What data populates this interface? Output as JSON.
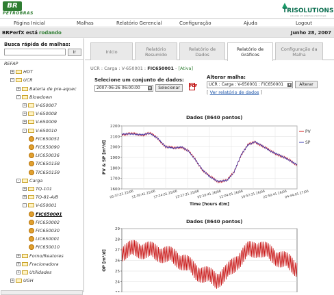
{
  "header": {
    "brand_mark": "BR",
    "brand_name": "PETROBRAS",
    "partner_name": "TRISOLUTIONS",
    "partner_tagline": "soluções em sistemas e tecnologia",
    "brand_color": "#2f7d32"
  },
  "menu": {
    "items": [
      "Página Inicial",
      "Malhas",
      "Relatório Gerencial",
      "Configuração",
      "Ajuda",
      "Logout"
    ]
  },
  "status": {
    "label": "BRPerfX está",
    "value": "rodando",
    "date": "Junho 28, 2007"
  },
  "search": {
    "label": "Busca rápida de malhas:",
    "value": "",
    "button": "Ir"
  },
  "tree": [
    {
      "label": "REFAP",
      "exp": "",
      "icon": "none"
    },
    {
      "label": "HDT",
      "exp": "+",
      "icon": "folder-icon"
    },
    {
      "label": "UCR",
      "exp": "-",
      "icon": "folder-icon"
    },
    {
      "label": "Bateria de pre-aquec",
      "exp": "+",
      "icon": "folder-icon"
    },
    {
      "label": "Blowdown",
      "exp": "-",
      "icon": "folder-icon"
    },
    {
      "label": "V-650007",
      "exp": "+",
      "icon": "folder-icon"
    },
    {
      "label": "V-650008",
      "exp": "+",
      "icon": "folder-icon"
    },
    {
      "label": "V-650009",
      "exp": "+",
      "icon": "folder-icon"
    },
    {
      "label": "V-650010",
      "exp": "-",
      "icon": "folder-icon"
    },
    {
      "label": "FIC650051",
      "exp": "",
      "icon": "gear-icon"
    },
    {
      "label": "FIC650090",
      "exp": "",
      "icon": "gear-icon"
    },
    {
      "label": "LIC650036",
      "exp": "",
      "icon": "gear-icon"
    },
    {
      "label": "TIC650158",
      "exp": "",
      "icon": "gear-icon"
    },
    {
      "label": "TIC650159",
      "exp": "",
      "icon": "gear-icon"
    },
    {
      "label": "Carga",
      "exp": "-",
      "icon": "folder-icon"
    },
    {
      "label": "TQ-101",
      "exp": "+",
      "icon": "folder-icon"
    },
    {
      "label": "TQ-81-A/B",
      "exp": "+",
      "icon": "folder-icon"
    },
    {
      "label": "V-650001",
      "exp": "-",
      "icon": "folder-icon"
    },
    {
      "label": "FIC650001",
      "exp": "",
      "icon": "gear-icon",
      "selected": true
    },
    {
      "label": "FIC650002",
      "exp": "",
      "icon": "gear-icon"
    },
    {
      "label": "FIC650030",
      "exp": "",
      "icon": "gear-icon"
    },
    {
      "label": "LIC650001",
      "exp": "",
      "icon": "gear-icon"
    },
    {
      "label": "PIC650010",
      "exp": "",
      "icon": "gear-icon"
    },
    {
      "label": "Forno/Reatores",
      "exp": "+",
      "icon": "folder-icon"
    },
    {
      "label": "Fracionadora",
      "exp": "+",
      "icon": "folder-icon"
    },
    {
      "label": "Utilidades",
      "exp": "+",
      "icon": "folder-icon"
    },
    {
      "label": "UGH",
      "exp": "+",
      "icon": "folder-icon"
    }
  ],
  "tabs": [
    {
      "line1": "Início",
      "line2": ""
    },
    {
      "line1": "Relatório",
      "line2": "Resumido"
    },
    {
      "line1": "Relatório de",
      "line2": "Dados"
    },
    {
      "line1": "Relatório de",
      "line2": "Gráficos",
      "active": true
    },
    {
      "line1": "Configuração da",
      "line2": "Malha"
    }
  ],
  "breadcrumb": {
    "path": "UCR : Carga : V-650001 : ",
    "current": "FIC650001",
    "status": "[Ativa]"
  },
  "dataset": {
    "label": "Selecione um conjunto de dados:",
    "value": "2007-06-26 06:00:00",
    "button": "Selecionar"
  },
  "loop_change": {
    "label": "Alterar malha:",
    "value": "UCR : Carga : V-650001 : FIC650001",
    "button": "Alterar",
    "link_prefix": "[ ",
    "link": "Ver relatório de dados",
    "link_suffix": " ]"
  },
  "chart_data": [
    {
      "type": "line",
      "title": "Dados (8640 pontos)",
      "xlabel": "Time [hours d/m]",
      "ylabel": "PV & SP [m³/d]",
      "ylim": [
        1600,
        2200
      ],
      "yticks": [
        1600,
        1700,
        1800,
        1900,
        2000,
        2100,
        2200
      ],
      "xticks": [
        "05:37:21 25/06",
        "11:30:41 25/06",
        "17:24:01 25/06",
        "23:17:21 25/06",
        "05:10:41 26/06",
        "11:04:01 26/06",
        "16:57:21 26/06",
        "22:50:41 26/06",
        "04:44:01 27/06"
      ],
      "legend": "right",
      "series": [
        {
          "name": "PV",
          "color": "#d01818",
          "x": [
            0,
            0.06,
            0.12,
            0.16,
            0.2,
            0.25,
            0.3,
            0.34,
            0.38,
            0.42,
            0.46,
            0.5,
            0.55,
            0.6,
            0.64,
            0.68,
            0.72,
            0.76,
            0.8,
            0.85,
            0.9,
            0.95,
            1
          ],
          "values": [
            2120,
            2125,
            2115,
            2130,
            2090,
            2000,
            1990,
            2000,
            1960,
            1880,
            1780,
            1720,
            1670,
            1680,
            1760,
            1920,
            2020,
            2050,
            2010,
            1960,
            1920,
            1880,
            1830
          ]
        },
        {
          "name": "SP",
          "color": "#3b3bb0",
          "x": [
            0,
            0.06,
            0.12,
            0.16,
            0.2,
            0.25,
            0.3,
            0.34,
            0.38,
            0.42,
            0.46,
            0.5,
            0.55,
            0.6,
            0.64,
            0.68,
            0.72,
            0.76,
            0.8,
            0.85,
            0.9,
            0.95,
            1
          ],
          "values": [
            2120,
            2125,
            2115,
            2130,
            2090,
            2000,
            1990,
            2000,
            1960,
            1880,
            1780,
            1720,
            1670,
            1680,
            1760,
            1920,
            2020,
            2050,
            2010,
            1960,
            1920,
            1880,
            1830
          ]
        }
      ]
    },
    {
      "type": "line",
      "title": "Dados (8640 pontos)",
      "xlabel": "",
      "ylabel": "OP [m³/d]",
      "ylim": [
        23,
        29
      ],
      "yticks": [
        23,
        24,
        25,
        26,
        27,
        28,
        29
      ],
      "series": [
        {
          "name": "OP",
          "color": "#c81414",
          "x": [
            0,
            0.08,
            0.16,
            0.24,
            0.3,
            0.36,
            0.42,
            0.48,
            0.54,
            0.6,
            0.66,
            0.72,
            0.78,
            0.84,
            0.9,
            0.95,
            1
          ],
          "values": [
            26.8,
            27.1,
            26.9,
            26.6,
            26.3,
            25.8,
            25.0,
            24.6,
            24.2,
            24.8,
            26.0,
            26.9,
            27.2,
            26.7,
            26.2,
            25.8,
            25.3
          ]
        }
      ]
    }
  ]
}
